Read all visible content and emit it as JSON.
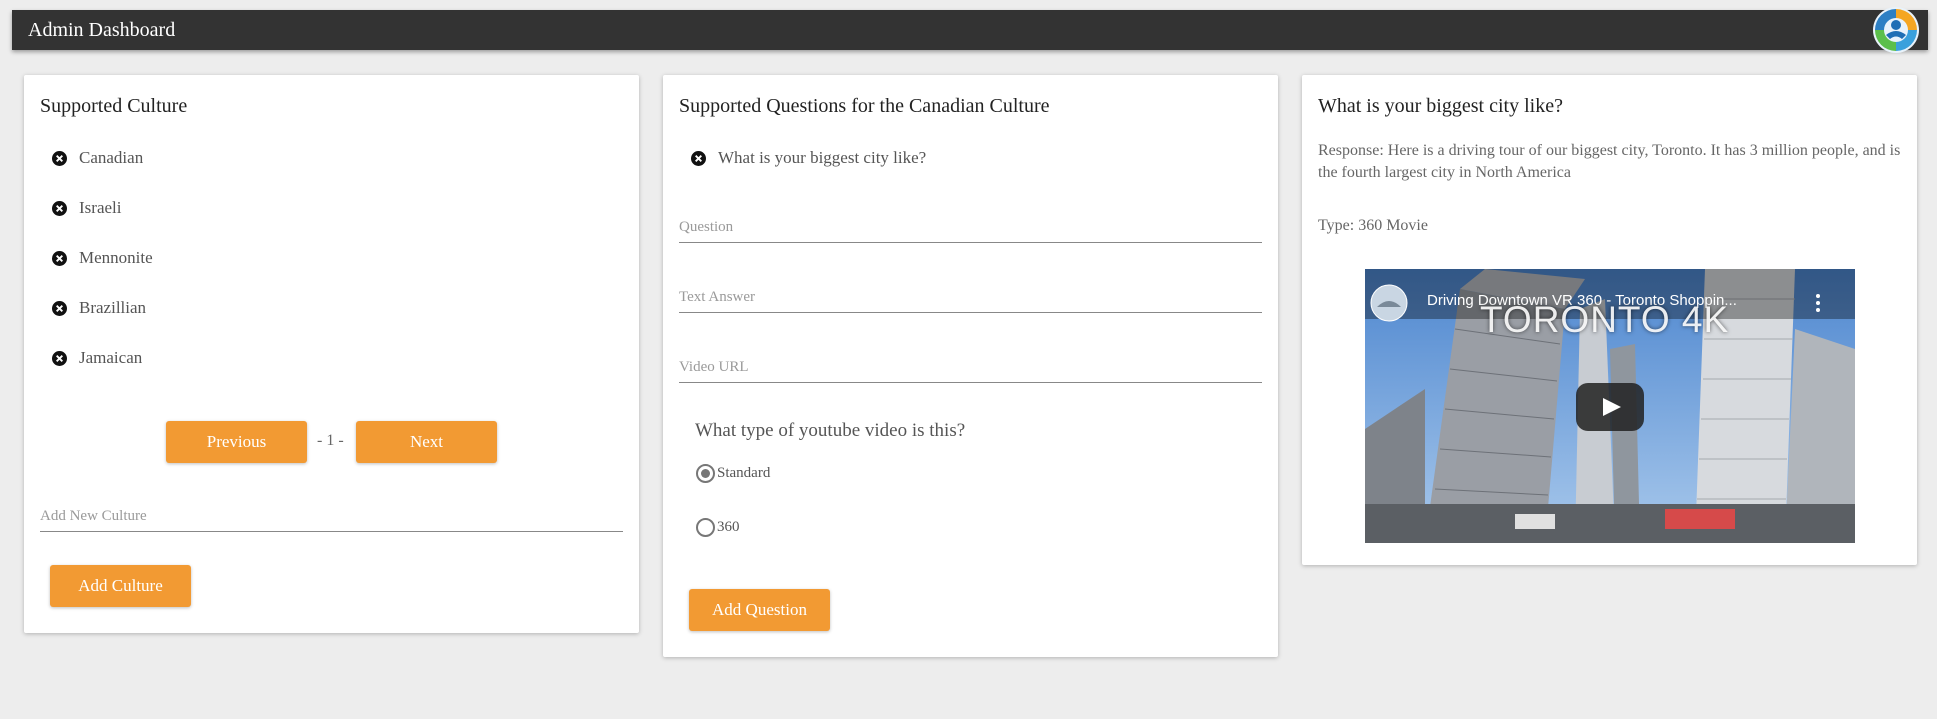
{
  "header": {
    "title": "Admin Dashboard",
    "logo_icon": "people-circle-logo"
  },
  "cultures": {
    "title": "Supported Culture",
    "items": [
      "Canadian",
      "Israeli",
      "Mennonite",
      "Brazillian",
      "Jamaican"
    ],
    "prev_label": "Previous",
    "page_indicator": "- 1 -",
    "next_label": "Next",
    "new_placeholder": "Add New Culture",
    "add_label": "Add Culture"
  },
  "questions": {
    "title": "Supported Questions for the Canadian Culture",
    "items": [
      "What is your biggest city like?"
    ],
    "question_placeholder": "Question",
    "answer_placeholder": "Text Answer",
    "video_placeholder": "Video URL",
    "video_type_prompt": "What type of youtube video is this?",
    "options": [
      {
        "label": "Standard",
        "selected": true
      },
      {
        "label": "360",
        "selected": false
      }
    ],
    "add_label": "Add Question"
  },
  "detail": {
    "title": "What is your biggest city like?",
    "response": "Response: Here is a driving tour of our biggest city, Toronto. It has 3 million people, and is the fourth largest city in North America",
    "type": "Type: 360 Movie",
    "video": {
      "title": "Driving Downtown VR 360 - Toronto Shoppin...",
      "overlay_text": "TORONTO 4K"
    }
  },
  "colors": {
    "accent": "#f29a33",
    "topbar": "#333333",
    "background": "#ededed"
  }
}
